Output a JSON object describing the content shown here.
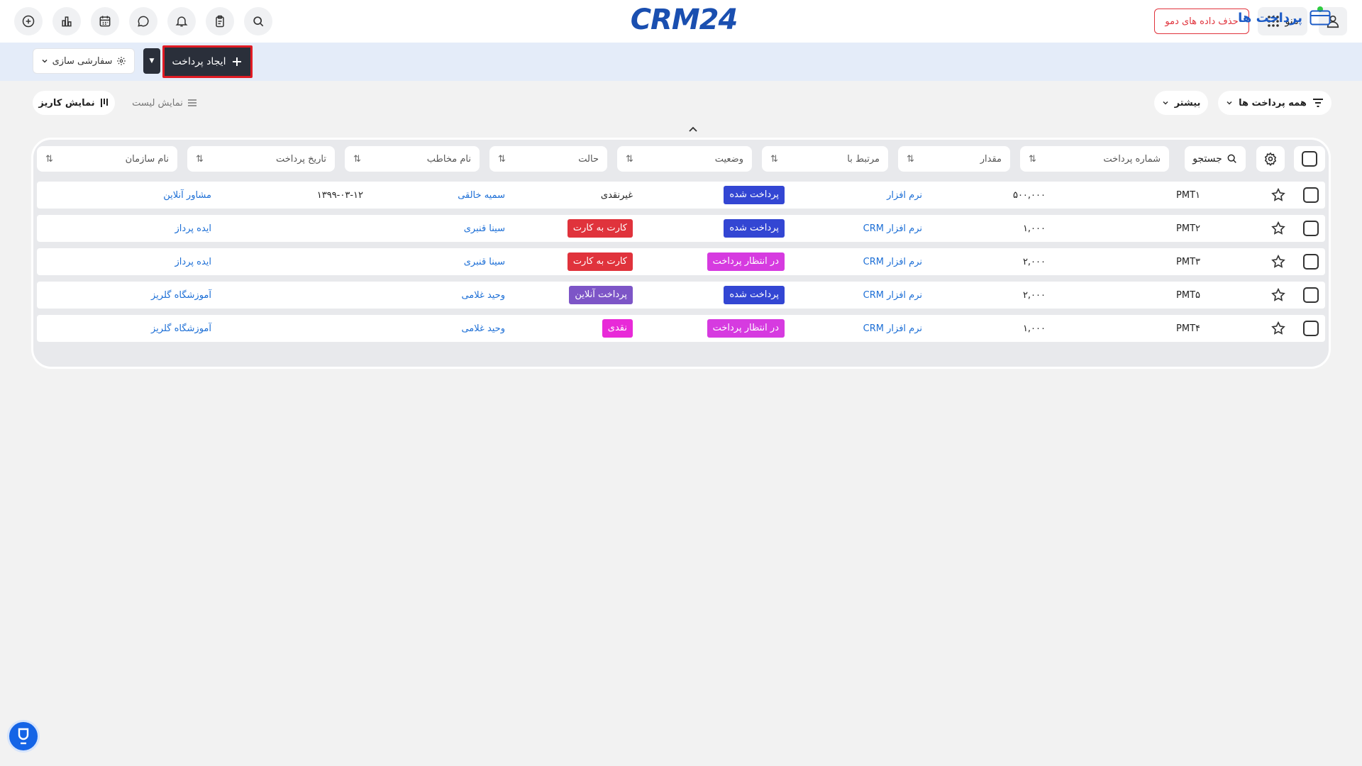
{
  "header": {
    "logo_text": "CRM24",
    "demo_button": "حذف داده های دمو",
    "menu_label": "منو"
  },
  "toolbar": {
    "page_title": "پرداخت ها",
    "create_button": "ایجاد پرداخت",
    "customize_button": "سفارشی سازی"
  },
  "filters": {
    "all_label": "همه پرداخت ها",
    "more_label": "بیشتر",
    "kanban_label": "نمایش کاریز",
    "list_label": "نمایش لیست"
  },
  "table": {
    "search_label": "جستجو",
    "columns": [
      "شماره پرداخت",
      "مقدار",
      "مرتبط با",
      "وضعیت",
      "حالت",
      "نام مخاطب",
      "تاریخ پرداخت",
      "نام سازمان"
    ],
    "rows": [
      {
        "number": "PMT۱",
        "amount": "۵۰۰,۰۰۰",
        "related": "نرم افزار",
        "status": "پرداخت شده",
        "mode": "غیرنقدی",
        "contact": "سمیه خالقی",
        "date": "۱۳۹۹-۰۳-۱۲",
        "org": "مشاور آنلاین"
      },
      {
        "number": "PMT۲",
        "amount": "۱,۰۰۰",
        "related": "نرم افزار CRM",
        "status": "پرداخت شده",
        "mode": "کارت به کارت",
        "contact": "سینا قنبری",
        "date": "",
        "org": "ایده پرداز"
      },
      {
        "number": "PMT۳",
        "amount": "۲,۰۰۰",
        "related": "نرم افزار CRM",
        "status": "در انتظار پرداخت",
        "mode": "کارت به کارت",
        "contact": "سینا قنبری",
        "date": "",
        "org": "ایده پرداز"
      },
      {
        "number": "PMT۵",
        "amount": "۲,۰۰۰",
        "related": "نرم افزار CRM",
        "status": "پرداخت شده",
        "mode": "پرداخت آنلاین",
        "contact": "وحید غلامی",
        "date": "",
        "org": "آموزشگاه گلریز"
      },
      {
        "number": "PMT۴",
        "amount": "۱,۰۰۰",
        "related": "نرم افزار CRM",
        "status": "در انتظار پرداخت",
        "mode": "نقدی",
        "contact": "وحید غلامی",
        "date": "",
        "org": "آموزشگاه گلریز"
      }
    ]
  },
  "colors": {
    "status_paid": "#3346d3",
    "status_pending": "#d63be0",
    "mode_card": "#e0333c",
    "mode_online": "#7d55c7",
    "mode_cash": "#e82ad8",
    "link": "#1d6fd6"
  },
  "icons": [
    "add-circle-icon",
    "bar-chart-icon",
    "calendar-icon",
    "chat-icon",
    "bell-icon",
    "clipboard-icon",
    "search-icon",
    "grid-icon",
    "user-icon",
    "card-icon",
    "plus-icon",
    "gear-icon",
    "filter-icon",
    "chevron-down-icon",
    "kanban-icon",
    "list-icon",
    "sort-icon",
    "star-icon",
    "checkbox-icon",
    "help-icon"
  ]
}
